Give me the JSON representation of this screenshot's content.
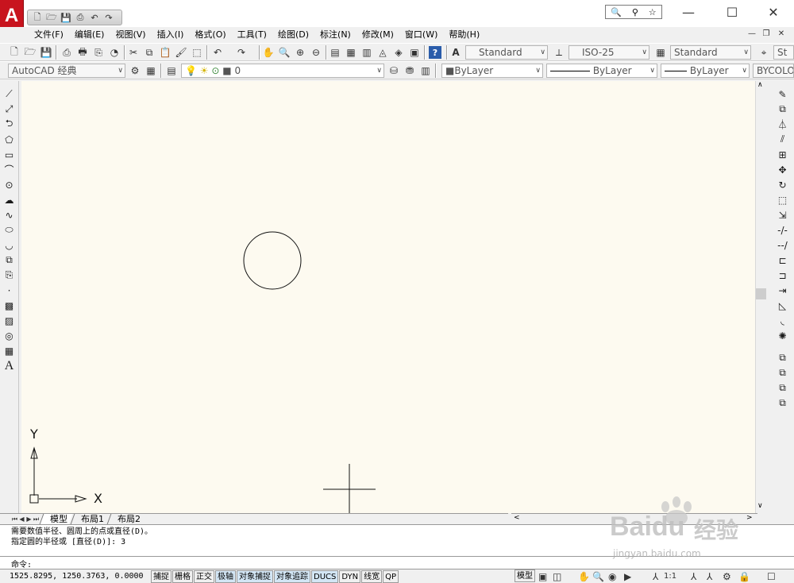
{
  "app": {
    "logo": "A"
  },
  "quick_access": {
    "icons": [
      "new-file-icon",
      "open-folder-icon",
      "save-icon",
      "print-icon",
      "undo-icon",
      "redo-icon"
    ]
  },
  "window_controls": {
    "search_icons": [
      "search-icon",
      "pin-icon",
      "star-icon"
    ],
    "minimize": "—",
    "maximize": "☐",
    "close": "✕"
  },
  "menu": {
    "items": [
      "文件(F)",
      "编辑(E)",
      "视图(V)",
      "插入(I)",
      "格式(O)",
      "工具(T)",
      "绘图(D)",
      "标注(N)",
      "修改(M)",
      "窗口(W)",
      "帮助(H)"
    ]
  },
  "styles": {
    "text_style": "Standard",
    "dim_style": "ISO-25",
    "table_style": "Standard",
    "multileader_style": "St"
  },
  "workspace": {
    "name": "AutoCAD 经典"
  },
  "layers": {
    "current": "0"
  },
  "properties": {
    "color": "ByLayer",
    "linetype": "ByLayer",
    "lineweight": "ByLayer",
    "plotstyle": "BYCOLOR"
  },
  "canvas": {
    "background": "#fdfaf0",
    "ucs_y_label": "Y",
    "ucs_x_label": "X"
  },
  "layout_tabs": [
    "模型",
    "布局1",
    "布局2"
  ],
  "command_line": {
    "history": [
      "需要数值半径、圆周上的点或直径(D)。",
      "指定圆的半径或 [直径(D)]: 3"
    ],
    "prompt": "命令:"
  },
  "status": {
    "coordinates": "1525.8295,  1250.3763,  0.0000",
    "toggles": [
      {
        "label": "捕捉",
        "on": false
      },
      {
        "label": "栅格",
        "on": false
      },
      {
        "label": "正交",
        "on": false
      },
      {
        "label": "极轴",
        "on": true
      },
      {
        "label": "对象捕捉",
        "on": true
      },
      {
        "label": "对象追踪",
        "on": true
      },
      {
        "label": "DUCS",
        "on": true
      },
      {
        "label": "DYN",
        "on": false
      },
      {
        "label": "线宽",
        "on": false
      },
      {
        "label": "QP",
        "on": false
      }
    ],
    "model_label": "模型",
    "annotation_scale": "1:1"
  },
  "watermark": {
    "brand": "Baidu",
    "brand_cn": "经验",
    "url": "jingyan.baidu.com"
  }
}
